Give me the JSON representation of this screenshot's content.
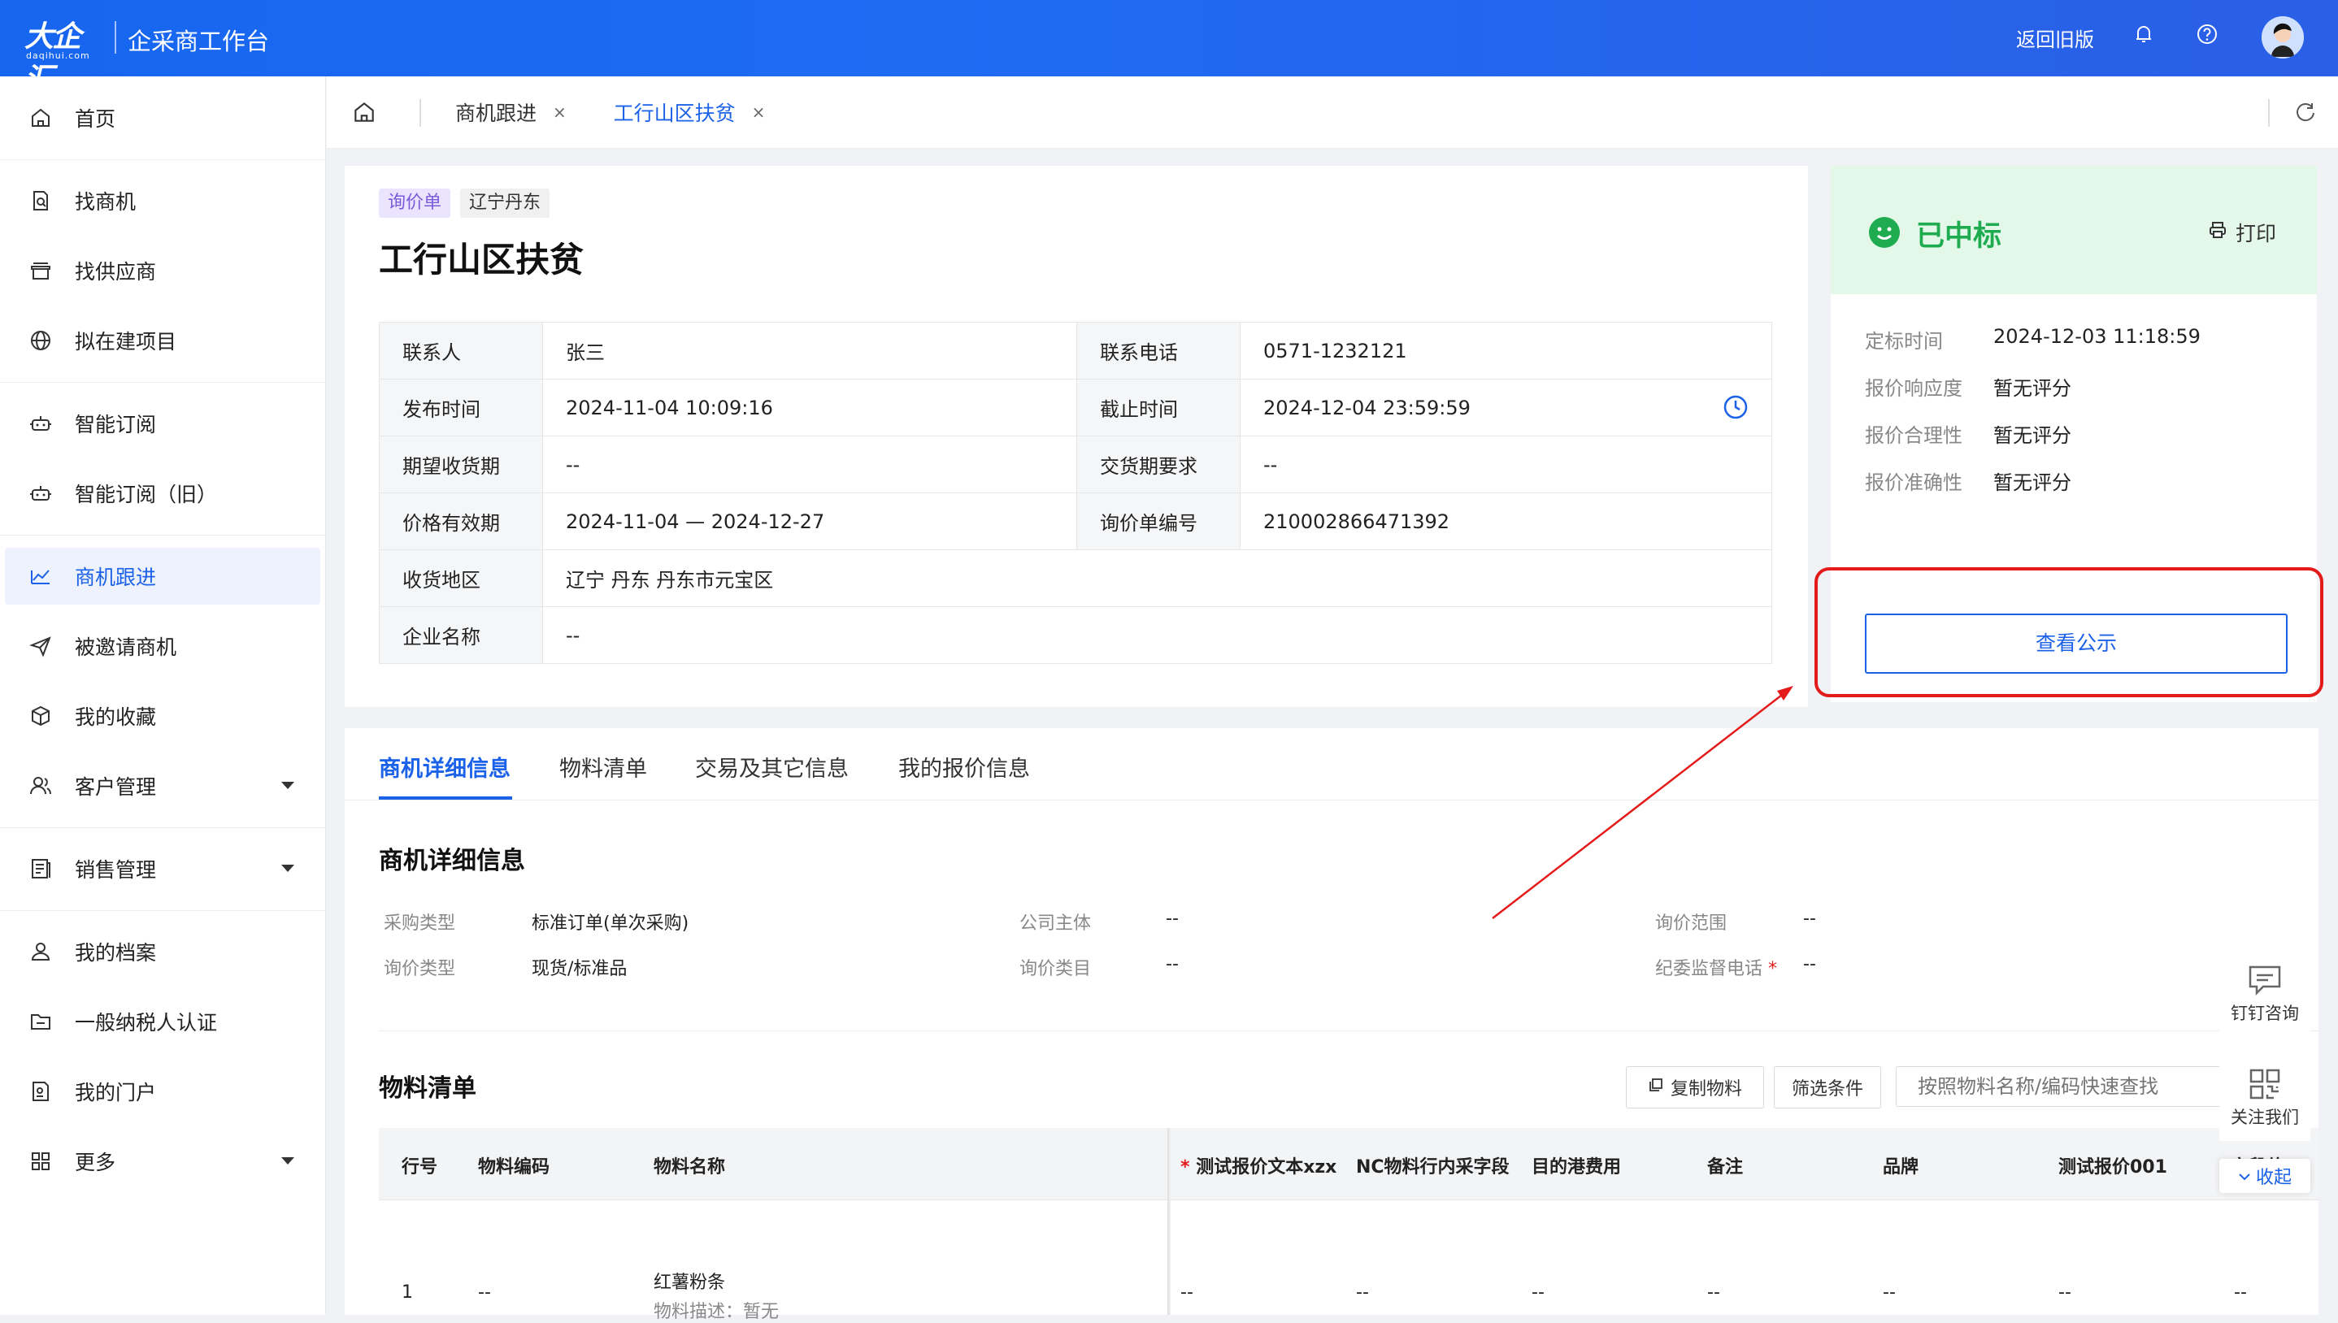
{
  "header": {
    "logo_text": "大企汇",
    "logo_sub": "daqihui.com",
    "app_title": "企采商工作台",
    "old_version": "返回旧版"
  },
  "sidebar": {
    "items": [
      {
        "label": "首页",
        "icon": "home-icon"
      },
      {
        "label": "找商机",
        "icon": "doc-search-icon"
      },
      {
        "label": "找供应商",
        "icon": "store-icon"
      },
      {
        "label": "拟在建项目",
        "icon": "globe-icon"
      },
      {
        "label": "智能订阅",
        "icon": "robot-icon"
      },
      {
        "label": "智能订阅（旧）",
        "icon": "robot-icon"
      },
      {
        "label": "商机跟进",
        "icon": "chart-icon"
      },
      {
        "label": "被邀请商机",
        "icon": "send-icon"
      },
      {
        "label": "我的收藏",
        "icon": "cube-icon"
      },
      {
        "label": "客户管理",
        "icon": "users-icon"
      },
      {
        "label": "销售管理",
        "icon": "ledger-icon"
      },
      {
        "label": "我的档案",
        "icon": "user-icon"
      },
      {
        "label": "一般纳税人认证",
        "icon": "folder-icon"
      },
      {
        "label": "我的门户",
        "icon": "portal-icon"
      },
      {
        "label": "更多",
        "icon": "grid-icon"
      }
    ]
  },
  "tabs": [
    {
      "label": "商机跟进"
    },
    {
      "label": "工行山区扶贫"
    }
  ],
  "detail": {
    "tag_type": "询价单",
    "tag_region": "辽宁丹东",
    "title": "工行山区扶贫",
    "rows": [
      {
        "l1": "联系人",
        "v1": "张三",
        "l2": "联系电话",
        "v2": "0571-1232121"
      },
      {
        "l1": "发布时间",
        "v1": "2024-11-04 10:09:16",
        "l2": "截止时间",
        "v2": "2024-12-04 23:59:59"
      },
      {
        "l1": "期望收货期",
        "v1": "--",
        "l2": "交货期要求",
        "v2": "--"
      },
      {
        "l1": "价格有效期",
        "v1": "2024-11-04 — 2024-12-27",
        "l2": "询价单编号",
        "v2": "210002866471392"
      }
    ],
    "address_label": "收货地区",
    "address_value": "辽宁 丹东 丹东市元宝区",
    "company_label": "企业名称",
    "company_value": "--"
  },
  "status": {
    "text": "已中标",
    "print": "打印",
    "fields": [
      {
        "k": "定标时间",
        "v": "2024-12-03 11:18:59"
      },
      {
        "k": "报价响应度",
        "v": "暂无评分"
      },
      {
        "k": "报价合理性",
        "v": "暂无评分"
      },
      {
        "k": "报价准确性",
        "v": "暂无评分"
      }
    ],
    "view_notice": "查看公示"
  },
  "detail_tabs": [
    "商机详细信息",
    "物料清单",
    "交易及其它信息",
    "我的报价信息"
  ],
  "business": {
    "title": "商机详细信息",
    "fields": [
      {
        "k": "采购类型",
        "v": "标准订单(单次采购)"
      },
      {
        "k": "公司主体",
        "v": "--"
      },
      {
        "k": "询价范围",
        "v": "--"
      },
      {
        "k": "询价类型",
        "v": "现货/标准品"
      },
      {
        "k": "询价类目",
        "v": "--"
      },
      {
        "k": "纪委监督电话",
        "v": "--"
      }
    ]
  },
  "materials": {
    "title": "物料清单",
    "copy_btn": "复制物料",
    "filter_btn": "筛选条件",
    "search_placeholder": "按照物料名称/编码快速查找",
    "columns": [
      "行号",
      "物料编码",
      "物料名称",
      "测试报价文本xzx",
      "NC物料行内采字段",
      "目的港费用",
      "备注",
      "品牌",
      "测试报价001",
      "字段值"
    ],
    "row": {
      "no": "1",
      "code": "--",
      "name": "红薯粉条",
      "desc": "物料描述：暂无",
      "c4": "--",
      "c5": "--",
      "c6": "--",
      "c7": "--",
      "c8": "--",
      "c9": "--",
      "c10": "--"
    }
  },
  "floats": {
    "dingtalk": "钉钉咨询",
    "follow": "关注我们",
    "collapse": "收起"
  }
}
